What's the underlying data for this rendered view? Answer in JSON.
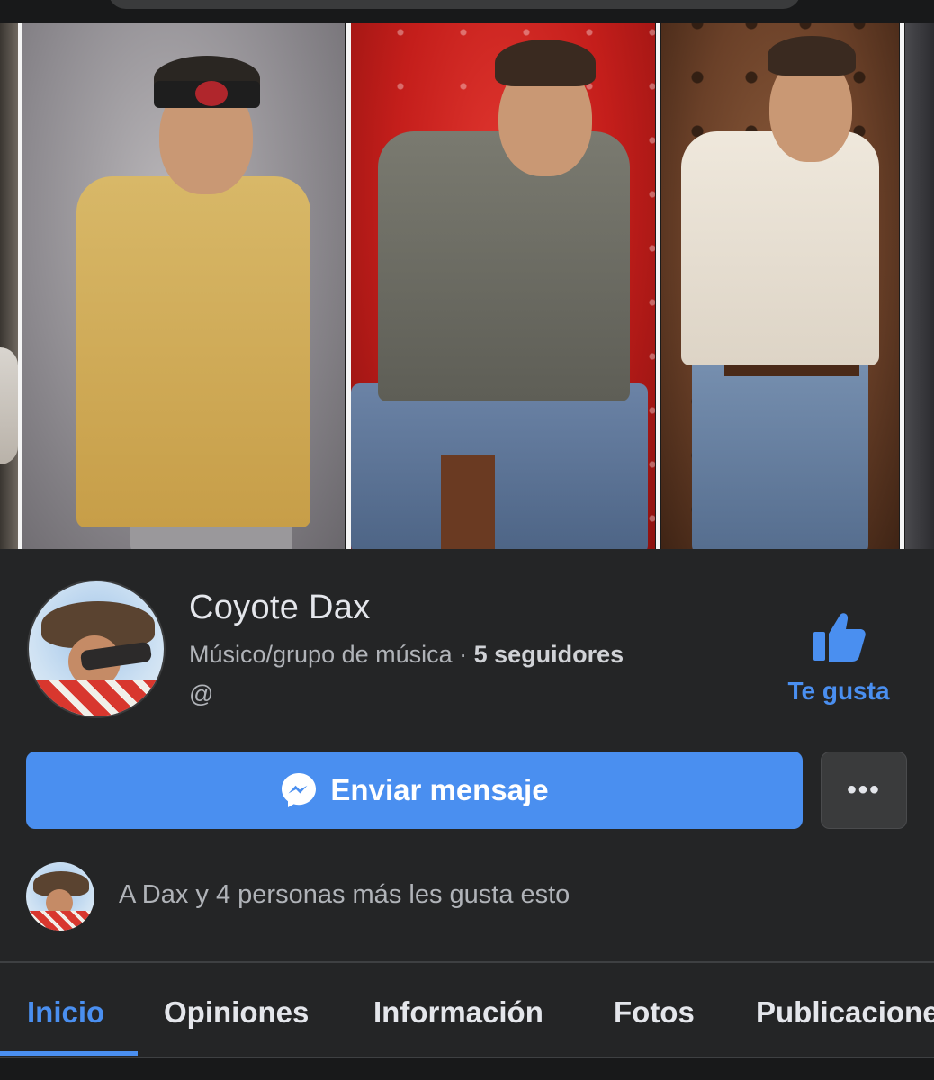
{
  "page": {
    "name": "Coyote Dax",
    "category": "Músico/grupo de música",
    "separator": " · ",
    "followers": "5 seguidores",
    "handle": "@"
  },
  "actions": {
    "like_label": "Te gusta",
    "message_label": "Enviar mensaje",
    "more_label": "•••"
  },
  "social": {
    "likes_text": "A Dax y 4 personas más les gusta esto"
  },
  "tabs": [
    {
      "label": "Inicio",
      "active": true
    },
    {
      "label": "Opiniones",
      "active": false
    },
    {
      "label": "Información",
      "active": false
    },
    {
      "label": "Fotos",
      "active": false
    },
    {
      "label": "Publicaciones",
      "active": false
    }
  ],
  "colors": {
    "background": "#242526",
    "accent": "#4a8ff0",
    "text_primary": "#e4e6eb",
    "text_secondary": "#b0b3b8"
  },
  "icons": {
    "like": "thumbs-up-icon",
    "message": "messenger-icon",
    "more": "more-dots-icon"
  }
}
